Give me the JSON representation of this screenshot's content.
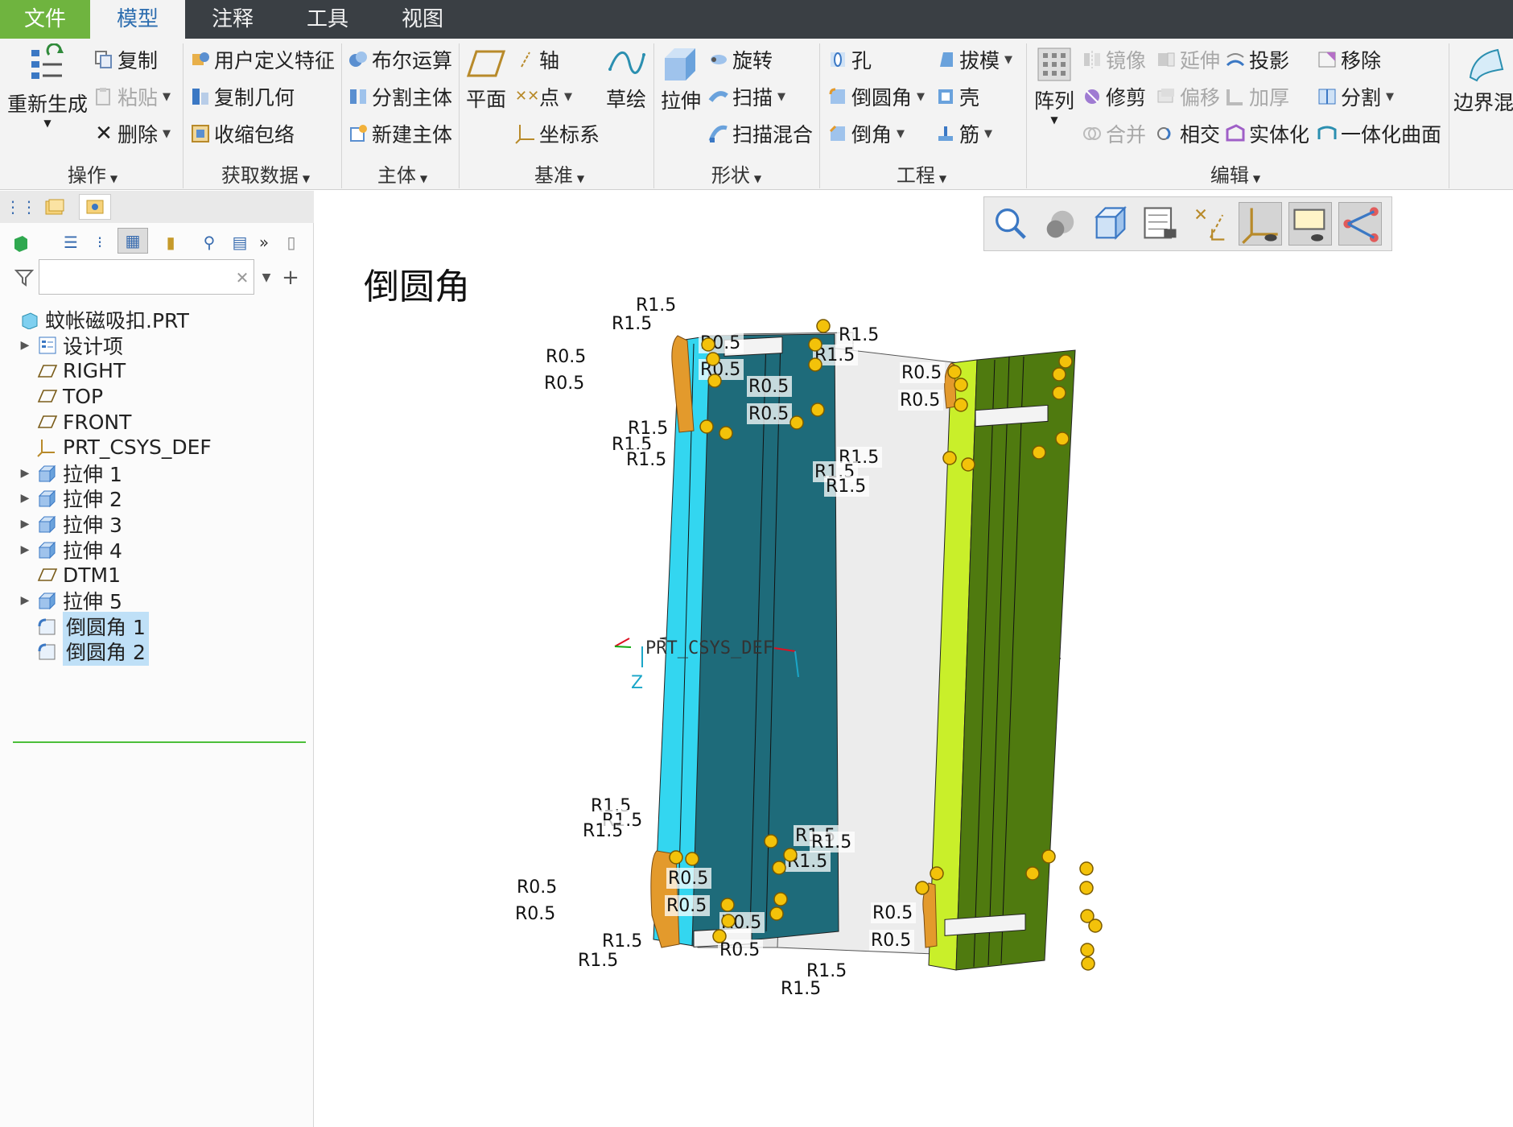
{
  "menubar": {
    "tabs": [
      "文件",
      "模型",
      "注释",
      "工具",
      "视图"
    ],
    "active_tab": "模型"
  },
  "ribbon": {
    "groups": {
      "operations": {
        "label": "操作",
        "regenerate": "重新生成",
        "copy": "复制",
        "paste": "粘贴",
        "delete": "删除"
      },
      "get_data": {
        "label": "获取数据",
        "udf": "用户定义特征",
        "copy_geom": "复制几何",
        "shrinkwrap": "收缩包络"
      },
      "body": {
        "label": "主体",
        "boolean": "布尔运算",
        "split_body": "分割主体",
        "new_body": "新建主体"
      },
      "datum": {
        "label": "基准",
        "plane": "平面",
        "axis": "轴",
        "point": "点",
        "csys": "坐标系",
        "sketch": "草绘"
      },
      "shapes": {
        "label": "形状",
        "extrude": "拉伸",
        "revolve": "旋转",
        "sweep": "扫描",
        "swept_blend": "扫描混合"
      },
      "engineering": {
        "label": "工程",
        "hole": "孔",
        "round": "倒圆角",
        "chamfer": "倒角",
        "draft": "拔模",
        "shell": "壳",
        "rib": "筋"
      },
      "editing": {
        "label": "编辑",
        "pattern": "阵列",
        "mirror": "镜像",
        "extend": "延伸",
        "project": "投影",
        "remove": "移除",
        "trim": "修剪",
        "offset": "偏移",
        "thicken": "加厚",
        "split": "分割",
        "merge": "合并",
        "intersect": "相交",
        "solidify": "实体化",
        "unify": "一体化曲面"
      },
      "surfaces": {
        "boundary_blend": "边界混"
      }
    }
  },
  "model_tree": {
    "root": "蚊帐磁吸扣.PRT",
    "items": [
      {
        "label": "设计项",
        "icon": "design-items-icon",
        "expandable": true,
        "selected": false
      },
      {
        "label": "RIGHT",
        "icon": "datum-plane-icon",
        "expandable": false,
        "selected": false
      },
      {
        "label": "TOP",
        "icon": "datum-plane-icon",
        "expandable": false,
        "selected": false
      },
      {
        "label": "FRONT",
        "icon": "datum-plane-icon",
        "expandable": false,
        "selected": false
      },
      {
        "label": "PRT_CSYS_DEF",
        "icon": "csys-icon",
        "expandable": false,
        "selected": false
      },
      {
        "label": "拉伸 1",
        "icon": "extrude-icon",
        "expandable": true,
        "selected": false
      },
      {
        "label": "拉伸 2",
        "icon": "extrude-icon",
        "expandable": true,
        "selected": false
      },
      {
        "label": "拉伸 3",
        "icon": "extrude-icon",
        "expandable": true,
        "selected": false
      },
      {
        "label": "拉伸 4",
        "icon": "extrude-icon",
        "expandable": true,
        "selected": false
      },
      {
        "label": "DTM1",
        "icon": "datum-plane-icon",
        "expandable": false,
        "selected": false
      },
      {
        "label": "拉伸 5",
        "icon": "extrude-icon",
        "expandable": true,
        "selected": false
      },
      {
        "label": "倒圆角 1",
        "icon": "round-icon",
        "expandable": false,
        "selected": true
      },
      {
        "label": "倒圆角 2",
        "icon": "round-icon",
        "expandable": false,
        "selected": true
      }
    ]
  },
  "viewport": {
    "title": "倒圆角",
    "csys_label": "PRT_CSYS_DEF",
    "axis_label": "Z",
    "colors": {
      "cyan_face": "#33d6f0",
      "teal_face": "#1e6b7a",
      "olive_face": "#4f7a0f",
      "lime_face": "#c9ef2a",
      "orange_round": "#e39a2c",
      "handle": "#f3c20a"
    },
    "dimensions": {
      "left_top": [
        "R1.5",
        "R1.5",
        "R0.5",
        "R0.5",
        "R0.5",
        "R0.5",
        "R1.5",
        "R1.5",
        "R1.5"
      ],
      "right_top": [
        "R1.5",
        "R1.5",
        "R0.5",
        "R0.5",
        "R0.5",
        "R0.5",
        "R1.5",
        "R1.5",
        "R1.5"
      ],
      "left_bottom": [
        "R1.5",
        "R1.5",
        "R1.5",
        "R0.5",
        "R0.5",
        "R0.5",
        "R0.5",
        "R1.5",
        "R1.5"
      ],
      "right_bottom": [
        "R1.5",
        "R1.5",
        "R1.5",
        "R0.5",
        "R0.5",
        "R0.5",
        "R0.5",
        "R1.5",
        "R1.5"
      ]
    },
    "view_toolbar": [
      "refit-icon",
      "display-style-icon",
      "saved-orientations-icon",
      "view-manager-icon",
      "datum-display-icon",
      "csys-display-icon",
      "annotation-display-icon",
      "spin-center-icon"
    ]
  }
}
